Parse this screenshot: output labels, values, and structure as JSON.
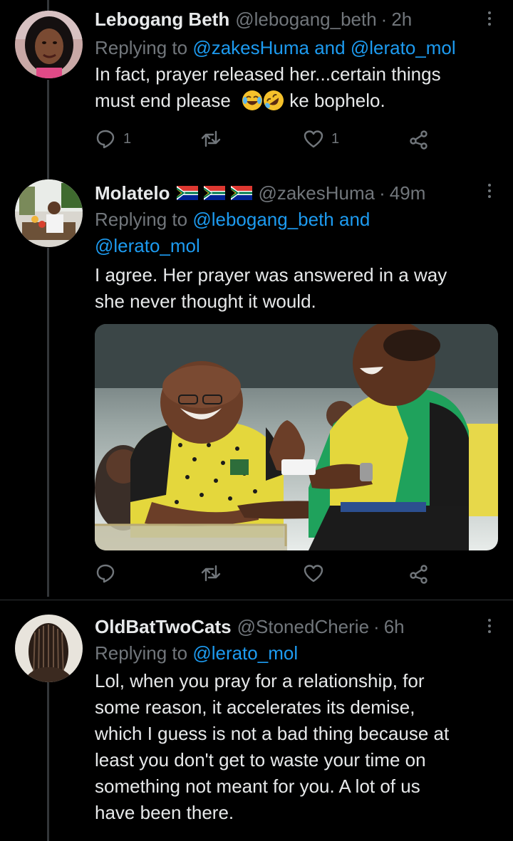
{
  "tweets": [
    {
      "name": "Lebogang Beth",
      "handle": "@lebogang_beth",
      "dot": "·",
      "time": "2h",
      "replying_prefix": "Replying to",
      "mentions": [
        "@zakesHuma",
        "@lerato_mol"
      ],
      "connector": "and",
      "text_line1": "In fact, prayer released her...certain things",
      "text_line2_a": "must end please",
      "text_line2_b": "ke bophelo.",
      "emojis": [
        "face-with-tears-of-joy",
        "rolling-on-floor-laughing"
      ],
      "reply_count": "1",
      "like_count": "1"
    },
    {
      "name": "Molatelo",
      "flags": [
        "south-africa-flag",
        "south-africa-flag",
        "south-africa-flag"
      ],
      "handle": "@zakesHuma",
      "dot": "·",
      "time": "49m",
      "replying_prefix": "Replying to",
      "mentions": [
        "@lebogang_beth",
        "@lerato_mol"
      ],
      "connector": "and",
      "text_line1": "I agree. Her prayer was answered in a way",
      "text_line2": "she never thought it would.",
      "reply_count": "",
      "like_count": ""
    },
    {
      "name": "OldBatTwoCats",
      "handle": "@StonedCherie",
      "dot": "·",
      "time": "6h",
      "replying_prefix": "Replying to",
      "mentions": [
        "@lerato_mol"
      ],
      "lines": [
        "Lol, when you pray for a relationship, for",
        "some reason, it accelerates its demise,",
        "which I guess is not a bad thing because at",
        "least you don't get to waste your time on",
        "something not meant for you. A lot of us",
        "have been there."
      ]
    }
  ],
  "colors": {
    "background": "#000000",
    "text": "#e7e9ea",
    "muted": "#71767b",
    "link": "#1d9bf0",
    "divider": "#2f3336"
  }
}
